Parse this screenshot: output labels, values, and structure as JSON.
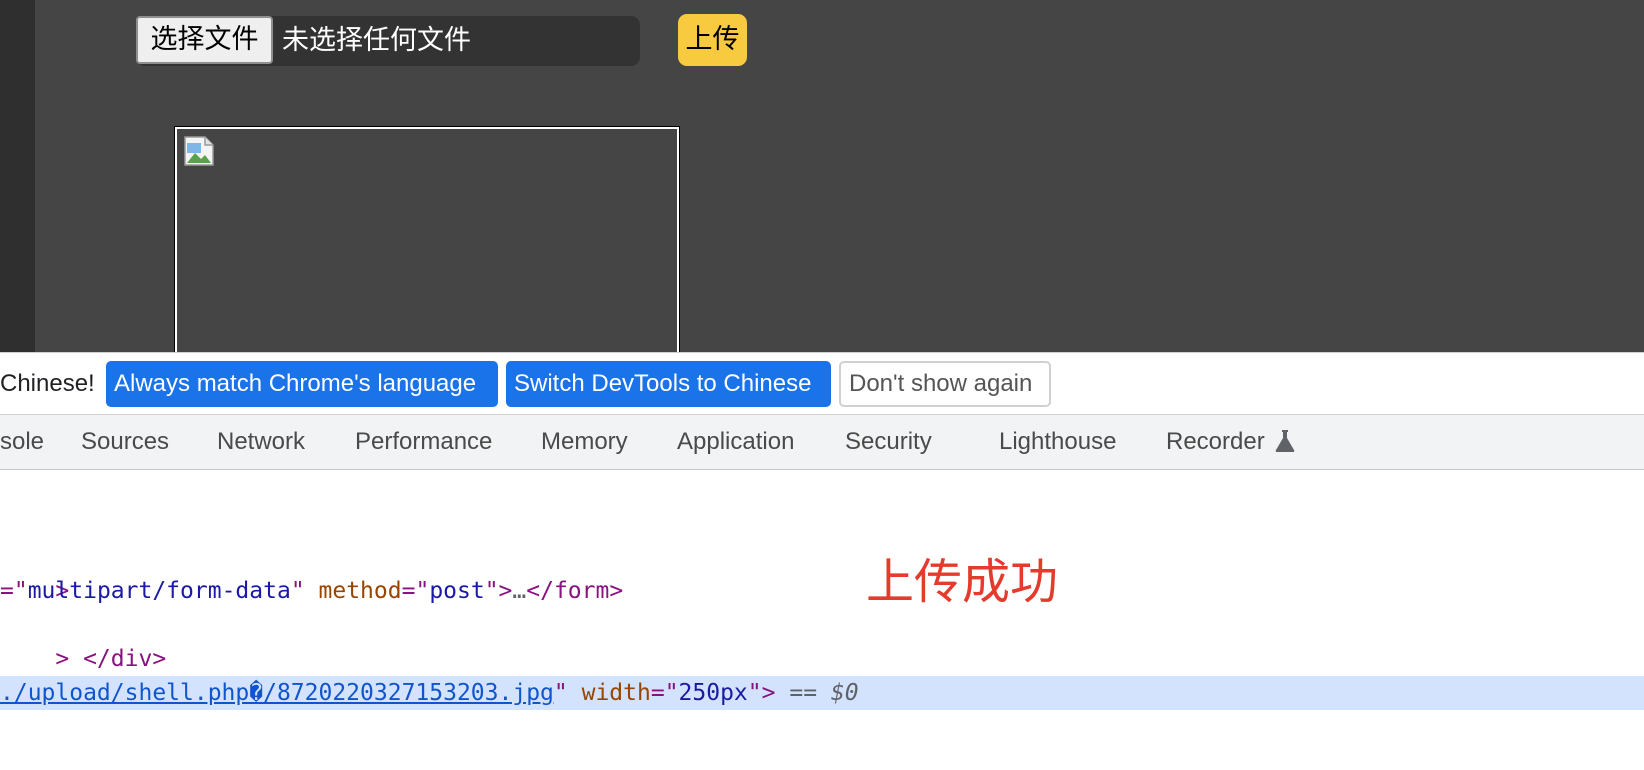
{
  "page": {
    "choose_file_label": "选择文件",
    "file_status": "未选择任何文件",
    "upload_label": "上传"
  },
  "lang_bar": {
    "message": "Chinese!",
    "always_match_label": "Always match Chrome's language",
    "switch_label": "Switch DevTools to Chinese",
    "dont_show_label": "Don't show again"
  },
  "tabs": [
    {
      "label": "sole"
    },
    {
      "label": "Sources"
    },
    {
      "label": "Network"
    },
    {
      "label": "Performance"
    },
    {
      "label": "Memory"
    },
    {
      "label": "Application"
    },
    {
      "label": "Security"
    },
    {
      "label": "Lighthouse"
    },
    {
      "label": "Recorder"
    }
  ],
  "elements": {
    "line1": {
      "tag_close": ">"
    },
    "line2": {
      "p1": "=\"",
      "v1": "multipart/form-data",
      "p2": "\" ",
      "attr": "method",
      "p3": "=\"",
      "v2": "post",
      "p4": "\">",
      "ellipsis": "…",
      "closing": "</form>"
    },
    "line3": {
      "text": "> </div>"
    },
    "line4": {
      "tag_close": ">"
    },
    "line5": {
      "src": "./upload/shell.php�/8720220327153203.jpg",
      "p1": "\" ",
      "attr": "width",
      "p2": "=\"",
      "v": "250px",
      "p3": "\">",
      "eq": " == ",
      "dollar": "$0"
    }
  },
  "annotation": {
    "text": "上传成功",
    "color": "#e53b2c"
  },
  "colors": {
    "page_bg": "#454545",
    "upload_btn": "#f7ca3f",
    "devtools_primary": "#1a73e8",
    "selected_row": "#d3e3fd"
  }
}
